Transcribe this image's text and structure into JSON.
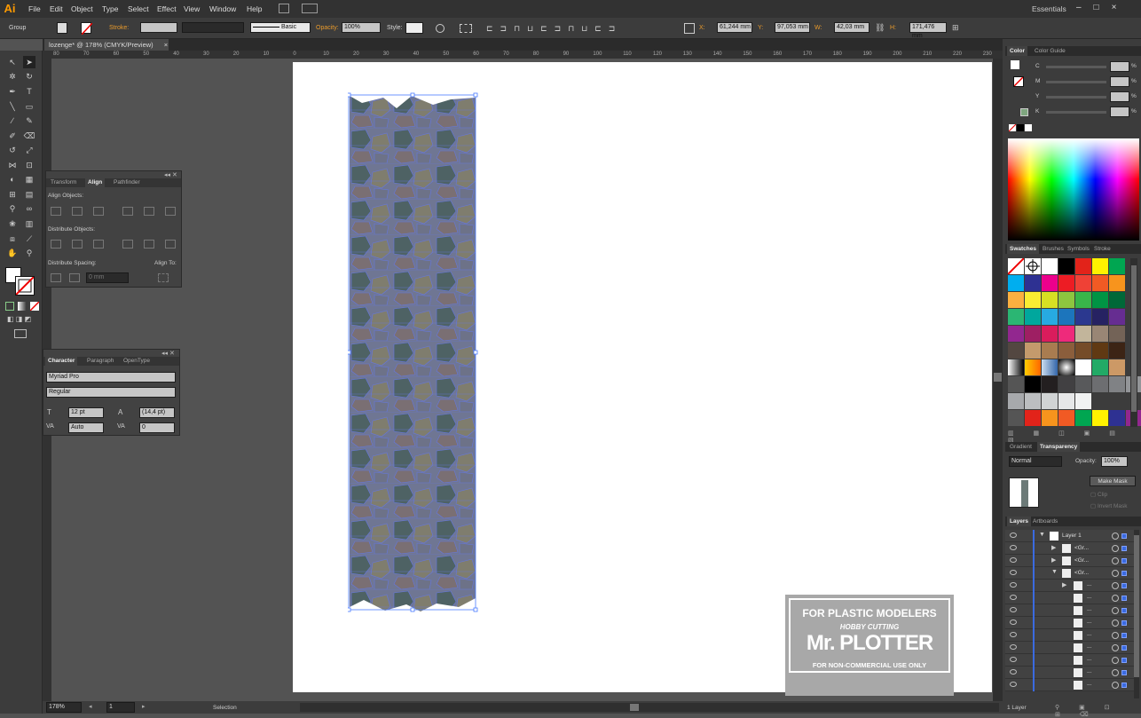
{
  "app": {
    "logo": "Ai"
  },
  "menu": [
    "File",
    "Edit",
    "Object",
    "Type",
    "Select",
    "Effect",
    "View",
    "Window",
    "Help"
  ],
  "workspace": "Essentials",
  "control": {
    "selection_type": "Group",
    "stroke_label": "Stroke:",
    "brush": "Basic",
    "opacity_label": "Opacity:",
    "opacity": "100%",
    "style_label": "Style:",
    "x_label": "X:",
    "x": "61,244 mm",
    "y_label": "Y:",
    "y": "97,053 mm",
    "w_label": "W:",
    "w": "42,03 mm",
    "h_label": "H:",
    "h": "171,476 mm"
  },
  "document": {
    "tab": "lozenge* @ 178% (CMYK/Preview)",
    "close": "×"
  },
  "ruler_labels": [
    "80",
    "70",
    "60",
    "50",
    "40",
    "30",
    "20",
    "10",
    "0",
    "10",
    "20",
    "30",
    "40",
    "50",
    "60",
    "70",
    "80",
    "90",
    "100",
    "110",
    "120",
    "130",
    "140",
    "150",
    "160",
    "170",
    "180",
    "190",
    "200",
    "210",
    "220",
    "230"
  ],
  "align_panel": {
    "tabs": [
      "Transform",
      "Align",
      "Pathfinder"
    ],
    "align_objects": "Align Objects:",
    "distribute_objects": "Distribute Objects:",
    "distribute_spacing": "Distribute Spacing:",
    "align_to": "Align To:",
    "spacing_value": "0 mm"
  },
  "character_panel": {
    "tabs": [
      "Character",
      "Paragraph",
      "OpenType"
    ],
    "font": "Myriad Pro",
    "style": "Regular",
    "size": "12 pt",
    "leading": "(14,4 pt)",
    "kerning": "Auto",
    "tracking": "0"
  },
  "color_panel": {
    "tabs": [
      "Color",
      "Color Guide"
    ],
    "channels": [
      "C",
      "M",
      "Y",
      "K"
    ],
    "unit": "%"
  },
  "swatch_tabs": [
    "Swatches",
    "Brushes",
    "Symbols",
    "Stroke"
  ],
  "swatch_colors": [
    [
      "none",
      "reg",
      "#ffffff",
      "#000000",
      "#e2231a",
      "#fff200",
      "#00a651"
    ],
    [
      "#00aeef",
      "#2e3192",
      "#ec008c",
      "#ed1c24",
      "#ef4136",
      "#f15a24",
      "#f7941d"
    ],
    [
      "#fbb040",
      "#f9ed32",
      "#d7df23",
      "#8dc63f",
      "#39b54a",
      "#009444",
      "#006838"
    ],
    [
      "#2bb673",
      "#00a79d",
      "#27aae1",
      "#1c75bc",
      "#2b388f",
      "#262262",
      "#662d91"
    ],
    [
      "#92278f",
      "#9e1f63",
      "#da1c5c",
      "#ee2a7b",
      "#c2b59b",
      "#998675",
      "#736357"
    ],
    [
      "#534741",
      "#c49a6c",
      "#a97c50",
      "#8b5e3c",
      "#754c29",
      "#603913",
      "#3c2415"
    ]
  ],
  "grays": [
    "#000000",
    "#231f20",
    "#414042",
    "#58595b",
    "#6d6e71",
    "#808285",
    "#939598"
  ],
  "grays2": [
    "#a7a9ac",
    "#bcbec0",
    "#d1d3d4",
    "#e6e7e8",
    "#f1f2f2"
  ],
  "bright": [
    "#e2231a",
    "#f7941d",
    "#f15a24",
    "#00a651",
    "#fff200",
    "#2e3192",
    "#92278f"
  ],
  "transparency": {
    "tabs": [
      "Gradient",
      "Transparency"
    ],
    "mode": "Normal",
    "opacity_label": "Opacity:",
    "opacity": "100%",
    "make_mask": "Make Mask",
    "clip": "Clip",
    "invert": "Invert Mask"
  },
  "layers": {
    "tabs": [
      "Layers",
      "Artboards"
    ],
    "layer1": "Layer 1",
    "groups": [
      "<Gr...",
      "<Gr...",
      "<Gr..."
    ],
    "sub": "...",
    "footer": "1 Layer"
  },
  "status": {
    "zoom": "178%",
    "page": "1",
    "tool": "Selection"
  },
  "watermark": {
    "line1": "FOR PLASTIC MODELERS",
    "line2": "HOBBY CUTTING",
    "line3": "Mr. PLOTTER",
    "line4": "FOR NON-COMMERCIAL USE ONLY"
  }
}
